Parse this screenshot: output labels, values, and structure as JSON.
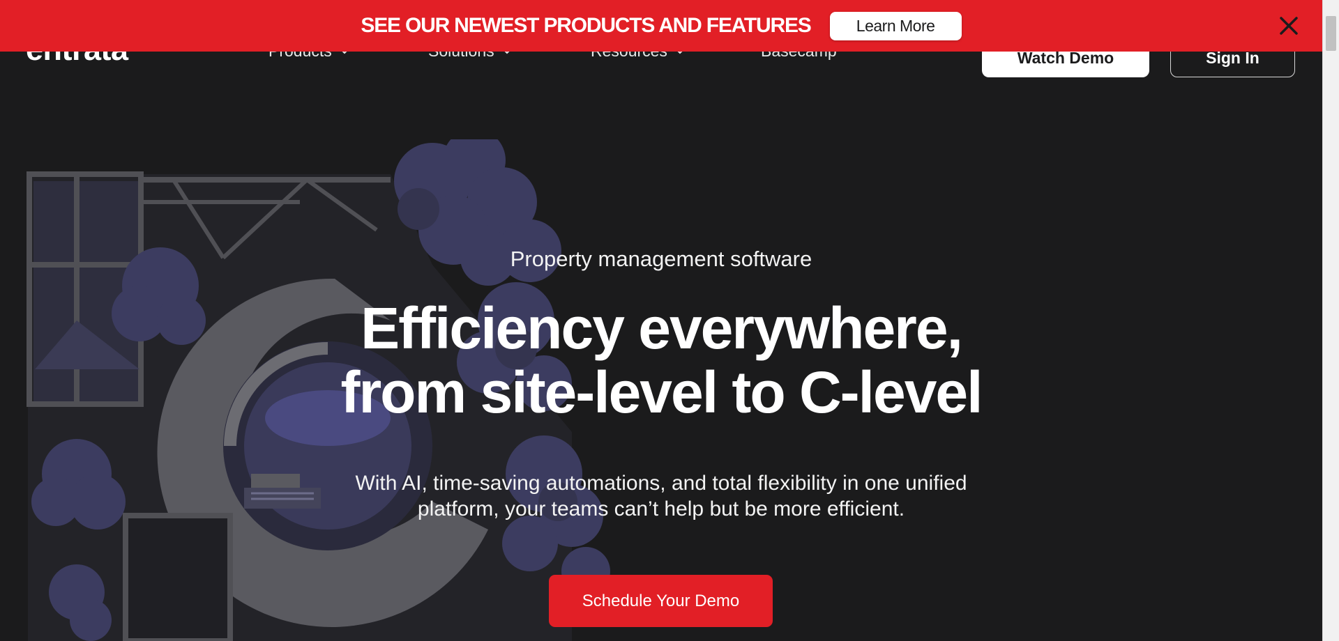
{
  "banner": {
    "text": "SEE OUR NEWEST PRODUCTS AND FEATURES",
    "button_label": "Learn More",
    "close_icon": "close-icon",
    "bg_color": "#e21f26"
  },
  "header": {
    "logo_text": "entrata",
    "nav": [
      {
        "label": "Products",
        "has_dropdown": true
      },
      {
        "label": "Solutions",
        "has_dropdown": true
      },
      {
        "label": "Resources",
        "has_dropdown": true
      },
      {
        "label": "Basecamp",
        "has_dropdown": false
      }
    ],
    "watch_demo_label": "Watch Demo",
    "sign_in_label": "Sign In"
  },
  "hero": {
    "eyebrow": "Property management software",
    "headline_line1": "Efficiency everywhere,",
    "headline_line2": "from site-level to C-level",
    "subtext": "With AI, time-saving automations, and total flexibility in one unified platform, your teams can’t help but be more efficient.",
    "cta_label": "Schedule Your Demo",
    "cta_color": "#e21f26"
  },
  "colors": {
    "page_bg": "#1b1b1c",
    "art_purple": "#3d3d5e",
    "art_gray": "#57575c"
  }
}
